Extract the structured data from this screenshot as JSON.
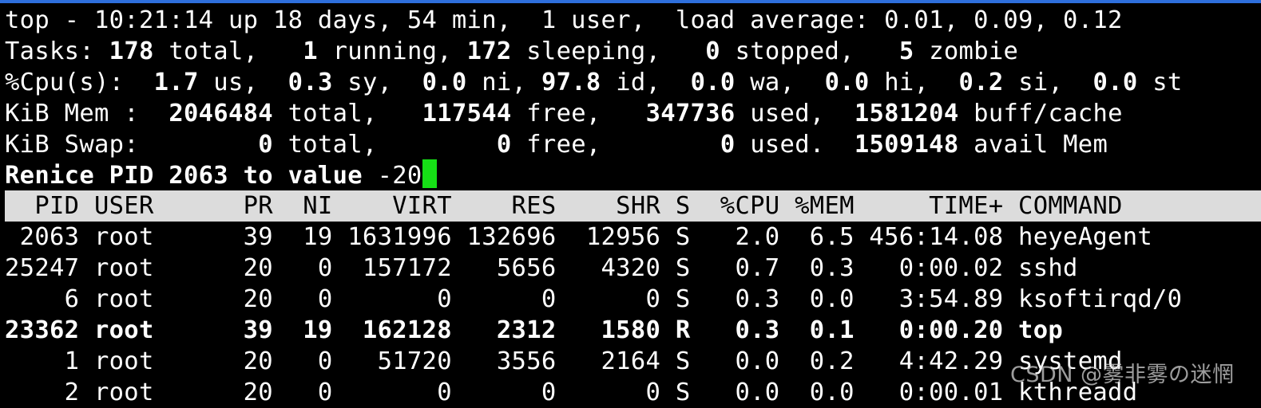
{
  "summary": {
    "uptime_line": "top - 10:21:14 up 18 days, 54 min,  1 user,  load average: 0.01, 0.09, 0.12",
    "tasks": {
      "label": "Tasks:",
      "total": "178",
      "total_lbl": " total,",
      "running": "1",
      "running_lbl": " running,",
      "sleeping": "172",
      "sleeping_lbl": " sleeping,",
      "stopped": "0",
      "stopped_lbl": " stopped,",
      "zombie": "5",
      "zombie_lbl": " zombie"
    },
    "cpu": {
      "label": "%Cpu(s):",
      "us": "1.7",
      "us_lbl": " us,",
      "sy": "0.3",
      "sy_lbl": " sy,",
      "ni": "0.0",
      "ni_lbl": " ni,",
      "id": "97.8",
      "id_lbl": " id,",
      "wa": "0.0",
      "wa_lbl": " wa,",
      "hi": "0.0",
      "hi_lbl": " hi,",
      "si": "0.2",
      "si_lbl": " si,",
      "st": "0.0",
      "st_lbl": " st"
    },
    "mem": {
      "label": "KiB Mem : ",
      "total": "2046484",
      "total_lbl": " total,",
      "free": "117544",
      "free_lbl": " free,",
      "used": "347736",
      "used_lbl": " used,",
      "buff": "1581204",
      "buff_lbl": " buff/cache"
    },
    "swap": {
      "label": "KiB Swap:",
      "total": "0",
      "total_lbl": " total,",
      "free": "0",
      "free_lbl": " free,",
      "used": "0",
      "used_lbl": " used.",
      "avail": "1509148",
      "avail_lbl": " avail Mem"
    }
  },
  "prompt": {
    "text": "Renice PID 2063 to value ",
    "input": "-20"
  },
  "table": {
    "header": "  PID USER      PR  NI    VIRT    RES    SHR S  %CPU %MEM     TIME+ COMMAND",
    "rows": [
      {
        "line": " 2063 root      39  19 1631996 132696  12956 S   2.0  6.5 456:14.08 heyeAgent",
        "bold": false
      },
      {
        "line": "25247 root      20   0  157172   5656   4320 S   0.7  0.3   0:00.02 sshd",
        "bold": false
      },
      {
        "line": "    6 root      20   0       0      0      0 S   0.3  0.0   3:54.89 ksoftirqd/0",
        "bold": false
      },
      {
        "line": "23362 root      39  19  162128   2312   1580 R   0.3  0.1   0:00.20 top",
        "bold": true
      },
      {
        "line": "    1 root      20   0   51720   3556   2164 S   0.0  0.2   4:42.29 systemd",
        "bold": false
      },
      {
        "line": "    2 root      20   0       0      0      0 S   0.0  0.0   0:00.01 kthreadd",
        "bold": false
      }
    ]
  },
  "watermark": "CSDN @雾非雾の迷惘",
  "colors": {
    "cursor": "#16e016",
    "header_bg": "#dcdcdc",
    "top_accent": "#2e6fdc"
  }
}
